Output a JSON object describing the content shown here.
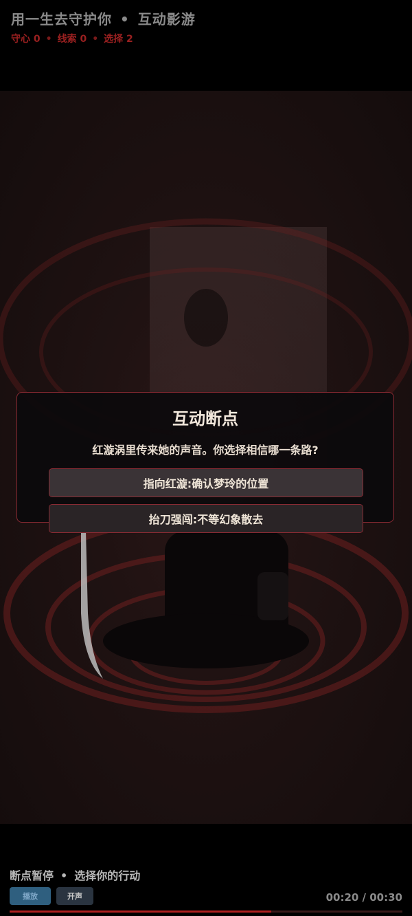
{
  "header": {
    "title": "用一生去守护你",
    "separator": "•",
    "mode": "互动影游",
    "stats": [
      {
        "label": "守心 0"
      },
      {
        "label": "线索 0"
      },
      {
        "label": "选择 2"
      }
    ],
    "stat_separator": "•"
  },
  "modal": {
    "title": "互动断点",
    "prompt": "红漩涡里传来她的声音。你选择相信哪一条路?",
    "choices": [
      {
        "label": "指向红漩:确认梦玲的位置"
      },
      {
        "label": "抬刀强闯:不等幻象散去"
      }
    ]
  },
  "footer": {
    "status": "断点暂停",
    "separator": "•",
    "hint": "选择你的行动",
    "play_label": "播放",
    "sound_label": "开声",
    "time": "00:20 / 00:30",
    "progress_fraction": 0.6667
  },
  "colors": {
    "accent_red": "#9a2020",
    "border_red": "#8a2a33",
    "play_blue": "#2f5f7f"
  }
}
